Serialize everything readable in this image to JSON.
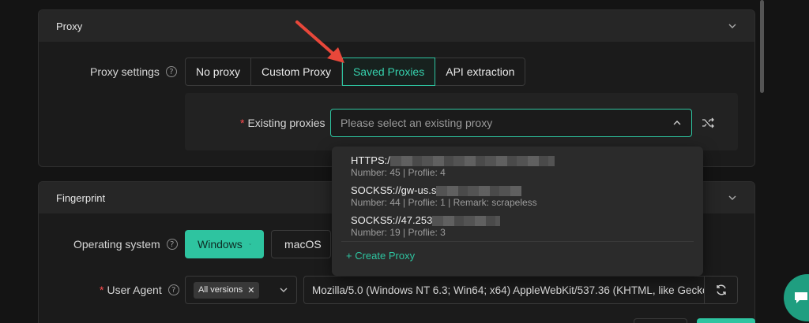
{
  "proxy_section": {
    "title": "Proxy",
    "settings_label": "Proxy settings",
    "tabs": [
      {
        "label": "No proxy"
      },
      {
        "label": "Custom Proxy"
      },
      {
        "label": "Saved Proxies"
      },
      {
        "label": "API extraction"
      }
    ],
    "active_tab": "Saved Proxies",
    "existing_label": "Existing proxies",
    "select_placeholder": "Please select an existing proxy",
    "dropdown": {
      "options": [
        {
          "main": "HTTPS:/",
          "sub": "Number: 45 | Proflie: 4"
        },
        {
          "main": "SOCKS5://gw-us.s",
          "sub": "Number: 44 | Proflie: 1 | Remark: scrapeless"
        },
        {
          "main": "SOCKS5://47.253",
          "sub": "Number: 19 | Proflie: 3"
        }
      ],
      "create_label": "+ Create Proxy"
    }
  },
  "fingerprint_section": {
    "title": "Fingerprint",
    "os_label": "Operating system",
    "os_options": [
      "Windows",
      "macOS"
    ],
    "ua_label": "User Agent",
    "ua_version_tag": "All versions",
    "ua_value": "Mozilla/5.0 (Windows NT 6.3; Win64; x64) AppleWebKit/537.36 (KHTML, like Gecko"
  },
  "colors": {
    "accent": "#2ec4a0",
    "arrow": "#e8473a"
  }
}
